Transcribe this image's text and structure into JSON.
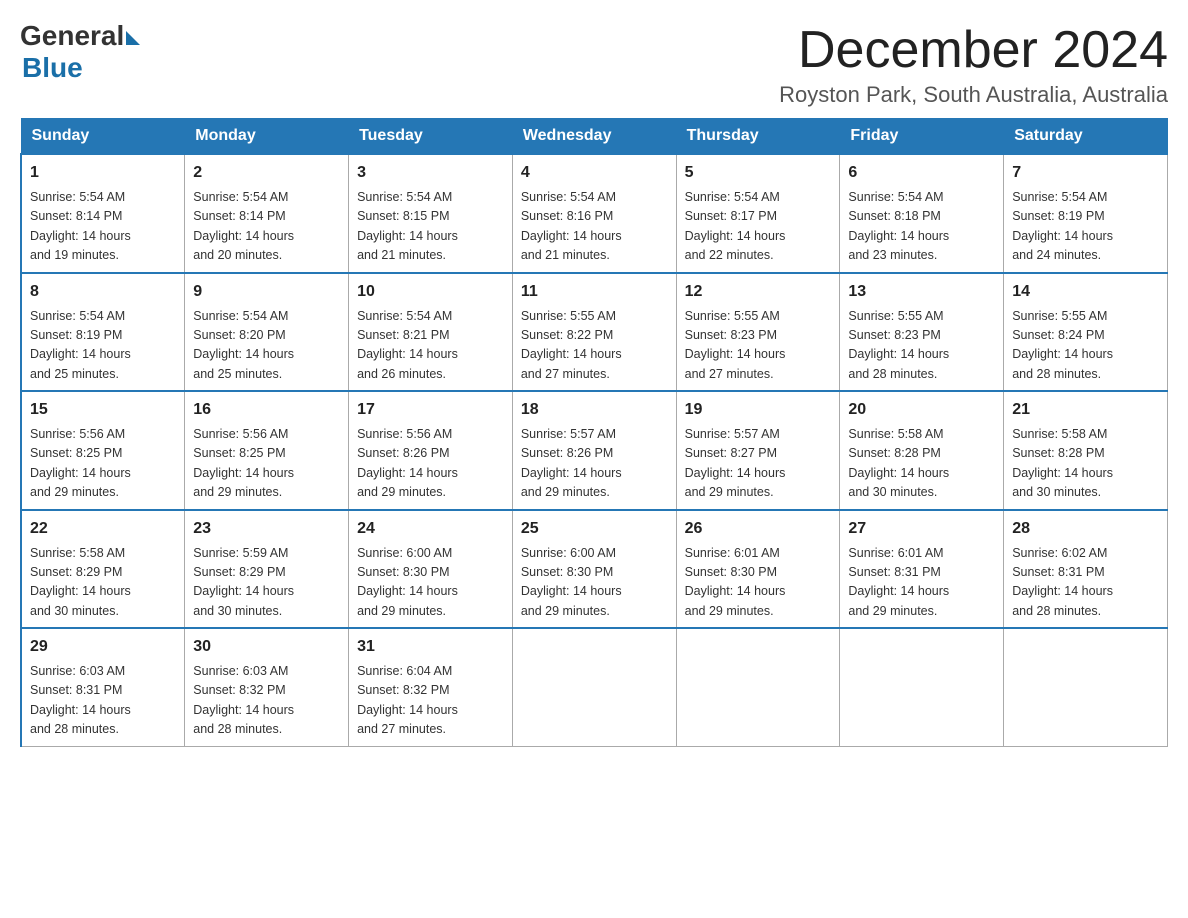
{
  "header": {
    "logo_general": "General",
    "logo_blue": "Blue",
    "title": "December 2024",
    "location": "Royston Park, South Australia, Australia"
  },
  "weekdays": [
    "Sunday",
    "Monday",
    "Tuesday",
    "Wednesday",
    "Thursday",
    "Friday",
    "Saturday"
  ],
  "weeks": [
    [
      {
        "num": "1",
        "sunrise": "5:54 AM",
        "sunset": "8:14 PM",
        "daylight": "14 hours and 19 minutes."
      },
      {
        "num": "2",
        "sunrise": "5:54 AM",
        "sunset": "8:14 PM",
        "daylight": "14 hours and 20 minutes."
      },
      {
        "num": "3",
        "sunrise": "5:54 AM",
        "sunset": "8:15 PM",
        "daylight": "14 hours and 21 minutes."
      },
      {
        "num": "4",
        "sunrise": "5:54 AM",
        "sunset": "8:16 PM",
        "daylight": "14 hours and 21 minutes."
      },
      {
        "num": "5",
        "sunrise": "5:54 AM",
        "sunset": "8:17 PM",
        "daylight": "14 hours and 22 minutes."
      },
      {
        "num": "6",
        "sunrise": "5:54 AM",
        "sunset": "8:18 PM",
        "daylight": "14 hours and 23 minutes."
      },
      {
        "num": "7",
        "sunrise": "5:54 AM",
        "sunset": "8:19 PM",
        "daylight": "14 hours and 24 minutes."
      }
    ],
    [
      {
        "num": "8",
        "sunrise": "5:54 AM",
        "sunset": "8:19 PM",
        "daylight": "14 hours and 25 minutes."
      },
      {
        "num": "9",
        "sunrise": "5:54 AM",
        "sunset": "8:20 PM",
        "daylight": "14 hours and 25 minutes."
      },
      {
        "num": "10",
        "sunrise": "5:54 AM",
        "sunset": "8:21 PM",
        "daylight": "14 hours and 26 minutes."
      },
      {
        "num": "11",
        "sunrise": "5:55 AM",
        "sunset": "8:22 PM",
        "daylight": "14 hours and 27 minutes."
      },
      {
        "num": "12",
        "sunrise": "5:55 AM",
        "sunset": "8:23 PM",
        "daylight": "14 hours and 27 minutes."
      },
      {
        "num": "13",
        "sunrise": "5:55 AM",
        "sunset": "8:23 PM",
        "daylight": "14 hours and 28 minutes."
      },
      {
        "num": "14",
        "sunrise": "5:55 AM",
        "sunset": "8:24 PM",
        "daylight": "14 hours and 28 minutes."
      }
    ],
    [
      {
        "num": "15",
        "sunrise": "5:56 AM",
        "sunset": "8:25 PM",
        "daylight": "14 hours and 29 minutes."
      },
      {
        "num": "16",
        "sunrise": "5:56 AM",
        "sunset": "8:25 PM",
        "daylight": "14 hours and 29 minutes."
      },
      {
        "num": "17",
        "sunrise": "5:56 AM",
        "sunset": "8:26 PM",
        "daylight": "14 hours and 29 minutes."
      },
      {
        "num": "18",
        "sunrise": "5:57 AM",
        "sunset": "8:26 PM",
        "daylight": "14 hours and 29 minutes."
      },
      {
        "num": "19",
        "sunrise": "5:57 AM",
        "sunset": "8:27 PM",
        "daylight": "14 hours and 29 minutes."
      },
      {
        "num": "20",
        "sunrise": "5:58 AM",
        "sunset": "8:28 PM",
        "daylight": "14 hours and 30 minutes."
      },
      {
        "num": "21",
        "sunrise": "5:58 AM",
        "sunset": "8:28 PM",
        "daylight": "14 hours and 30 minutes."
      }
    ],
    [
      {
        "num": "22",
        "sunrise": "5:58 AM",
        "sunset": "8:29 PM",
        "daylight": "14 hours and 30 minutes."
      },
      {
        "num": "23",
        "sunrise": "5:59 AM",
        "sunset": "8:29 PM",
        "daylight": "14 hours and 30 minutes."
      },
      {
        "num": "24",
        "sunrise": "6:00 AM",
        "sunset": "8:30 PM",
        "daylight": "14 hours and 29 minutes."
      },
      {
        "num": "25",
        "sunrise": "6:00 AM",
        "sunset": "8:30 PM",
        "daylight": "14 hours and 29 minutes."
      },
      {
        "num": "26",
        "sunrise": "6:01 AM",
        "sunset": "8:30 PM",
        "daylight": "14 hours and 29 minutes."
      },
      {
        "num": "27",
        "sunrise": "6:01 AM",
        "sunset": "8:31 PM",
        "daylight": "14 hours and 29 minutes."
      },
      {
        "num": "28",
        "sunrise": "6:02 AM",
        "sunset": "8:31 PM",
        "daylight": "14 hours and 28 minutes."
      }
    ],
    [
      {
        "num": "29",
        "sunrise": "6:03 AM",
        "sunset": "8:31 PM",
        "daylight": "14 hours and 28 minutes."
      },
      {
        "num": "30",
        "sunrise": "6:03 AM",
        "sunset": "8:32 PM",
        "daylight": "14 hours and 28 minutes."
      },
      {
        "num": "31",
        "sunrise": "6:04 AM",
        "sunset": "8:32 PM",
        "daylight": "14 hours and 27 minutes."
      },
      null,
      null,
      null,
      null
    ]
  ],
  "labels": {
    "sunrise": "Sunrise:",
    "sunset": "Sunset:",
    "daylight": "Daylight:"
  }
}
